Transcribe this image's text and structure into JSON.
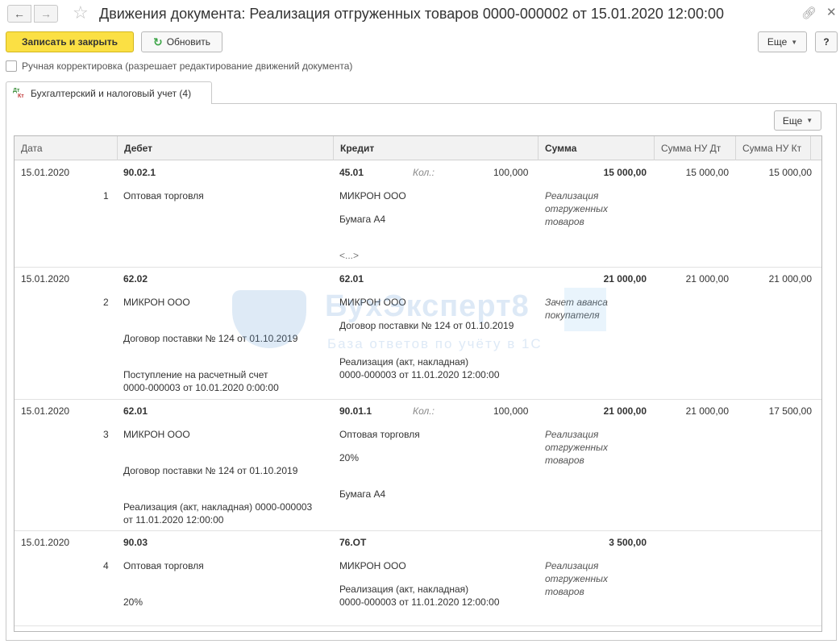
{
  "window": {
    "title": "Движения документа: Реализация отгруженных товаров 0000-000002 от 15.01.2020 12:00:00",
    "back_icon": "arrow-left-icon",
    "forward_icon": "arrow-right-icon",
    "favorite_icon": "star-icon",
    "link_icon": "link-icon",
    "close_icon": "close-icon"
  },
  "toolbar": {
    "save_close_label": "Записать и закрыть",
    "refresh_label": "Обновить",
    "more_label": "Еще",
    "help_label": "?"
  },
  "manual_correction": {
    "label": "Ручная корректировка (разрешает редактирование движений документа)",
    "checked": false
  },
  "tab": {
    "label": "Бухгалтерский и налоговый учет (4)",
    "icon": "dt-kt-icon"
  },
  "panel": {
    "more_label": "Еще"
  },
  "table": {
    "headers": {
      "date": "Дата",
      "debit": "Дебет",
      "credit": "Кредит",
      "amount": "Сумма",
      "nu_dt": "Сумма НУ Дт",
      "nu_kt": "Сумма НУ Кт"
    },
    "rows": [
      {
        "date": "15.01.2020",
        "n": "1",
        "debit_account": "90.02.1",
        "debit_sub1": "Оптовая торговля",
        "credit_account": "45.01",
        "kol_label": "Кол.:",
        "kol_value": "100,000",
        "credit_sub1": "МИКРОН ООО",
        "credit_sub2": "Бумага А4",
        "credit_more": "<...>",
        "amount": "15 000,00",
        "content": "Реализация отгруженных товаров",
        "nu_dt": "15 000,00",
        "nu_kt": "15 000,00"
      },
      {
        "date": "15.01.2020",
        "n": "2",
        "debit_account": "62.02",
        "debit_sub1": "МИКРОН ООО",
        "debit_sub2": "Договор поставки № 124 от 01.10.2019",
        "debit_sub3_line1": "Поступление на расчетный счет",
        "debit_sub3_line2": "0000-000003 от 10.01.2020 0:00:00",
        "credit_account": "62.01",
        "credit_sub1": "МИКРОН ООО",
        "credit_sub2": "Договор поставки № 124 от 01.10.2019",
        "credit_sub3_line1": "Реализация (акт, накладная)",
        "credit_sub3_line2": "0000-000003 от 11.01.2020 12:00:00",
        "amount": "21 000,00",
        "content": "Зачет аванса покупателя",
        "nu_dt": "21 000,00",
        "nu_kt": "21 000,00"
      },
      {
        "date": "15.01.2020",
        "n": "3",
        "debit_account": "62.01",
        "debit_sub1": "МИКРОН ООО",
        "debit_sub2": "Договор поставки № 124 от 01.10.2019",
        "debit_sub3_line1": "Реализация (акт, накладная) 0000-000003",
        "debit_sub3_line2": "от 11.01.2020 12:00:00",
        "credit_account": "90.01.1",
        "kol_label": "Кол.:",
        "kol_value": "100,000",
        "credit_sub1": "Оптовая торговля",
        "credit_sub2": "20%",
        "credit_sub3": "Бумага А4",
        "amount": "21 000,00",
        "content": "Реализация отгруженных товаров",
        "nu_dt": "21 000,00",
        "nu_kt": "17 500,00"
      },
      {
        "date": "15.01.2020",
        "n": "4",
        "debit_account": "90.03",
        "debit_sub1": "Оптовая торговля",
        "debit_sub2": "20%",
        "credit_account": "76.ОТ",
        "credit_sub1": "МИКРОН ООО",
        "credit_sub2_line1": "Реализация (акт, накладная)",
        "credit_sub2_line2": "0000-000003 от 11.01.2020 12:00:00",
        "amount": "3 500,00",
        "content": "Реализация отгруженных товаров"
      }
    ]
  },
  "watermark": {
    "title": "БухЭксперт8",
    "subtitle": "База ответов по учёту в 1С"
  }
}
